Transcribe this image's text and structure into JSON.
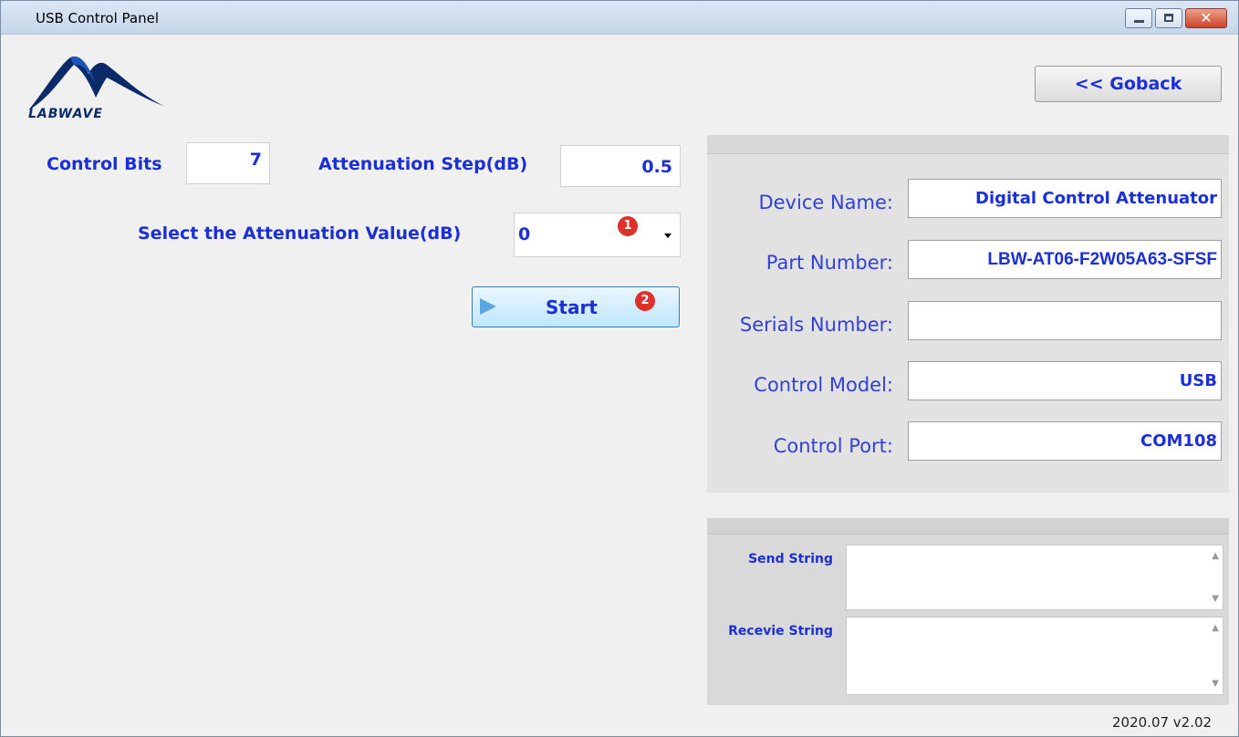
{
  "window": {
    "title": "USB Control Panel",
    "minimize_glyph": "",
    "close_glyph": "✕"
  },
  "logo": {
    "text": "LABWAVE",
    "icon": "labwave-wave-logo"
  },
  "header": {
    "goback_label": "<< Goback"
  },
  "controls": {
    "control_bits_label": "Control Bits",
    "control_bits_value": "7",
    "att_step_label": "Attenuation Step(dB)",
    "att_step_value": "0.5",
    "select_att_label": "Select the Attenuation Value(dB)",
    "select_att_value": "0",
    "start_label": "Start",
    "badge_1": "1",
    "badge_2": "2"
  },
  "device": {
    "fields": [
      {
        "label": "Device Name:",
        "value": "Digital Control Attenuator"
      },
      {
        "label": "Part Number:",
        "value": "LBW-AT06-F2W05A63-SFSF"
      },
      {
        "label": "Serials Number:",
        "value": ""
      },
      {
        "label": "Control Model:",
        "value": "USB"
      },
      {
        "label": "Control Port:",
        "value": "COM108"
      }
    ]
  },
  "comm": {
    "send_label": "Send String",
    "send_value": "",
    "receive_label": "Recevie String",
    "receive_value": ""
  },
  "footer": {
    "version": "2020.07 v2.02"
  },
  "colors": {
    "accent_text": "#1a2fd8",
    "badge": "#e0302a",
    "titlebar": "#c6d6ea"
  }
}
